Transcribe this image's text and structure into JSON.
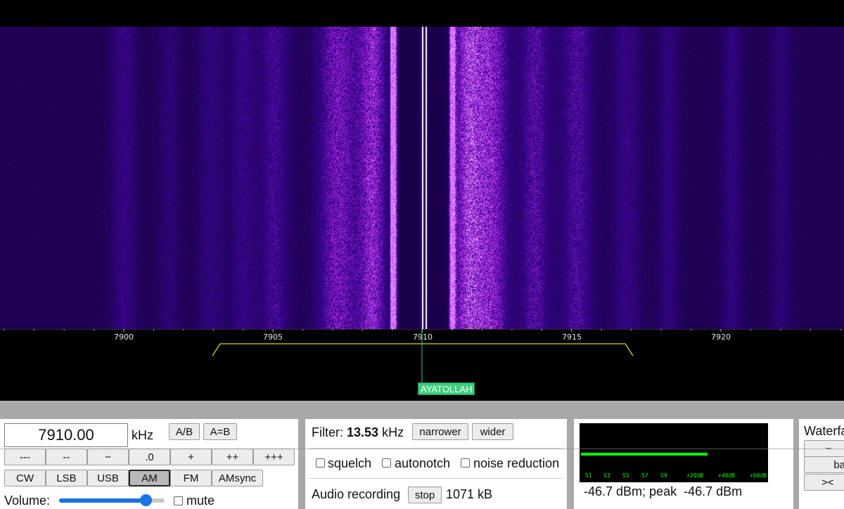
{
  "waterfall": {
    "frequency_labels": [
      "7900",
      "7905",
      "7910",
      "7915",
      "7920"
    ],
    "station_label": "AYATOLLAH"
  },
  "tuning": {
    "frequency": "7910.00",
    "unit": "kHz",
    "ab_label": "A/B",
    "aeqb_label": "A=B",
    "step_buttons": [
      "---",
      "--",
      "−",
      ".0",
      "+",
      "++",
      "+++"
    ],
    "modes": [
      "CW",
      "LSB",
      "USB",
      "AM",
      "FM",
      "AMsync"
    ],
    "active_mode": "AM",
    "volume_label": "Volume:",
    "volume_level": 0.82,
    "mute_label": "mute"
  },
  "filter": {
    "label": "Filter:",
    "width_value": "13.53",
    "width_unit": "kHz",
    "narrower_label": "narrower",
    "wider_label": "wider",
    "squelch_label": "squelch",
    "autonotch_label": "autonotch",
    "noise_reduction_label": "noise reduction",
    "recording_label": "Audio recording",
    "stop_label": "stop",
    "recording_size": "1071 kB"
  },
  "smeter": {
    "scale_labels": [
      "S1",
      "S3",
      "S5",
      "S7",
      "S9",
      "+20dB",
      "+40dB",
      "+60dB"
    ],
    "readout": "-46.7 dBm; peak  -46.7 dBm",
    "bar_color": "#00ff00"
  },
  "waterfall_panel": {
    "title": "Waterfa",
    "minus_label": "−",
    "ba_label": "ba",
    "arrows_label": "><"
  },
  "colors": {
    "waterfall_base": "#2a0a8a",
    "signal_peak": "#ffffff",
    "filter_passband": "#d8d820",
    "tuning_line": "#3ccf7d"
  }
}
